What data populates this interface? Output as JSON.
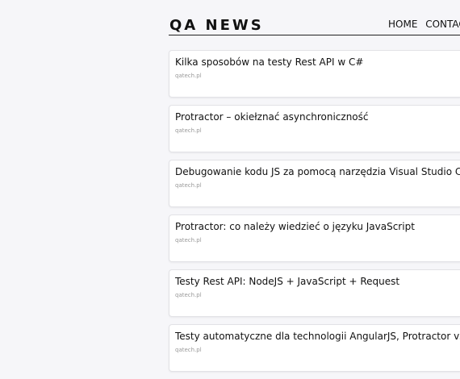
{
  "header": {
    "logo": "QA NEWS",
    "nav": [
      {
        "label": "HOME"
      },
      {
        "label": "CONTAC"
      }
    ]
  },
  "news": [
    {
      "title": "Kilka sposobów na testy Rest API w C#",
      "source": "qatech.pl"
    },
    {
      "title": "Protractor – okiełznać asynchroniczność",
      "source": "qatech.pl"
    },
    {
      "title": "Debugowanie kodu JS za pomocą narzędzia Visual Studio Code",
      "source": "qatech.pl"
    },
    {
      "title": "Protractor: co należy wiedzieć o języku JavaScript",
      "source": "qatech.pl"
    },
    {
      "title": "Testy Rest API: NodeJS + JavaScript + Request",
      "source": "qatech.pl"
    },
    {
      "title": "Testy automatyczne dla technologii AngularJS, Protractor vs Se",
      "source": "qatech.pl"
    }
  ]
}
